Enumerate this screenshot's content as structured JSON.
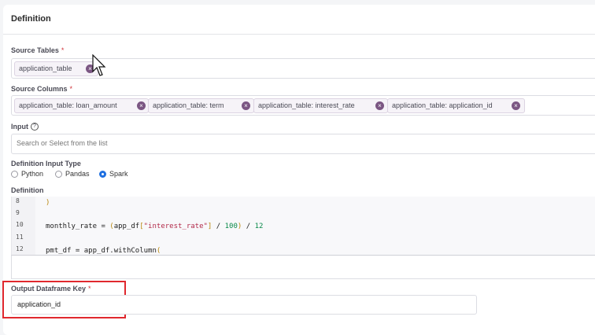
{
  "section": {
    "title": "Definition"
  },
  "source_tables": {
    "label": "Source Tables",
    "required_mark": "*",
    "chips": [
      "application_table"
    ]
  },
  "source_columns": {
    "label": "Source Columns",
    "required_mark": "*",
    "chips": [
      "application_table: loan_amount",
      "application_table: term",
      "application_table: interest_rate",
      "application_table: application_id"
    ]
  },
  "input": {
    "label": "Input",
    "help_icon": "question-circle-icon",
    "placeholder": "Search or Select from the list"
  },
  "definition_input_type": {
    "label": "Definition Input Type",
    "options": [
      "Python",
      "Pandas",
      "Spark"
    ],
    "selected": "Spark"
  },
  "definition": {
    "label": "Definition",
    "lines": [
      {
        "num": "8",
        "text": ")"
      },
      {
        "num": "9",
        "text": ""
      },
      {
        "num": "10",
        "text": "monthly_rate = (app_df[\"interest_rate\"] / 100) / 12"
      },
      {
        "num": "11",
        "text": ""
      },
      {
        "num": "12",
        "text": "pmt_df = app_df.withColumn("
      }
    ]
  },
  "output": {
    "label": "Output Dataframe Key",
    "required_mark": "*",
    "value": "application_id"
  },
  "colors": {
    "accent": "#1e6fe0",
    "chip_remove": "#7b5683",
    "highlight": "#e0282e",
    "required": "#d0343a"
  }
}
